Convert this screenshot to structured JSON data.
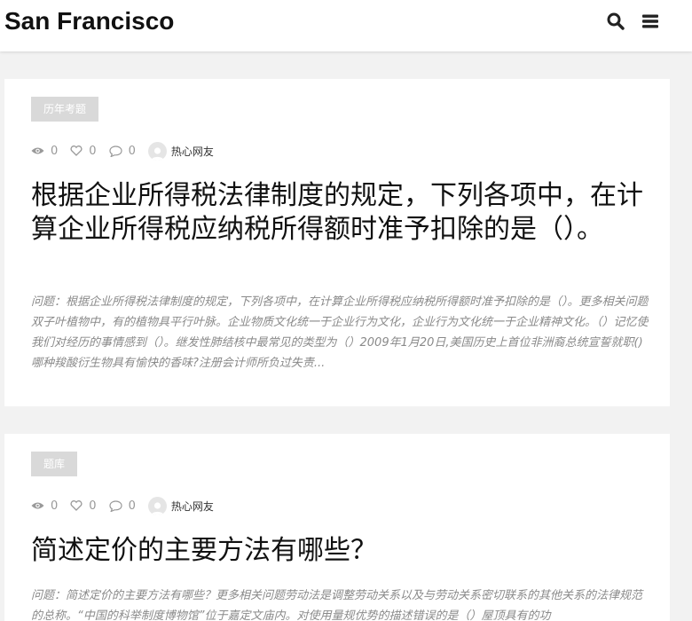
{
  "header": {
    "site_title": "San Francisco",
    "search_icon": "search-icon",
    "menu_icon": "menu-icon"
  },
  "posts": [
    {
      "tag": "历年考题",
      "views": "0",
      "likes": "0",
      "comments": "0",
      "author": "热心网友",
      "title": "根据企业所得税法律制度的规定，下列各项中，在计算企业所得税应纳税所得额时准予扣除的是（）。",
      "excerpt": "问题：根据企业所得税法律制度的规定，下列各项中，在计算企业所得税应纳税所得额时准予扣除的是（）。更多相关问题双子叶植物中，有的植物具平行叶脉。企业物质文化统一于企业行为文化，企业行为文化统一于企业精神文化。（）记忆使我们对经历的事情感到（）。继发性肺结核中最常见的类型为（）2009年1月20日,美国历史上首位非洲裔总统宣誓就职()哪种羧酸衍生物具有愉快的香味?注册会计师所负过失责..."
    },
    {
      "tag": "题库",
      "views": "0",
      "likes": "0",
      "comments": "0",
      "author": "热心网友",
      "title": "简述定价的主要方法有哪些？",
      "excerpt": "问题：简述定价的主要方法有哪些？更多相关问题劳动法是调整劳动关系以及与劳动关系密切联系的其他关系的法律规范的总称。“中国的科举制度博物馆”位于嘉定文庙内。对使用量规优势的描述错误的是（）屋顶具有的功"
    }
  ],
  "colors": {
    "background": "#f2f2f2",
    "card": "#ffffff",
    "tag_bg": "#d9d9d9",
    "meta": "#999999",
    "excerpt": "#8a8a8a"
  }
}
